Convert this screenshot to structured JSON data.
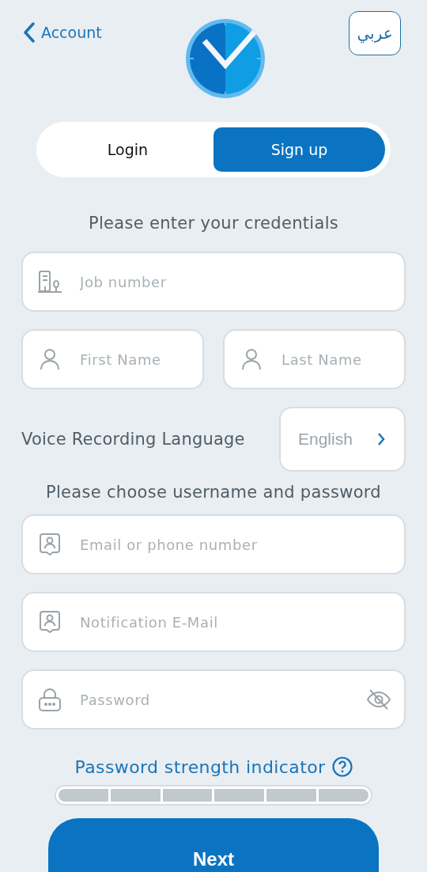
{
  "header": {
    "back_label": "Account",
    "language_button": "عربي"
  },
  "tabs": [
    {
      "label": "Login",
      "selected": false
    },
    {
      "label": "Sign up",
      "selected": true
    }
  ],
  "credentials_heading": "Please enter your credentials",
  "job_field": {
    "kind": "building",
    "placeholder": "Job number"
  },
  "name_fields": [
    {
      "kind": "person",
      "placeholder": "First Name"
    },
    {
      "kind": "person",
      "placeholder": "Last Name"
    }
  ],
  "voice_language": {
    "label": "Voice Recording Language",
    "value": "English"
  },
  "account_heading": "Please choose username and password",
  "account_fields": [
    {
      "kind": "contact",
      "placeholder": "Email or phone number"
    },
    {
      "kind": "contact",
      "placeholder": "Notification E-Mail"
    },
    {
      "kind": "lock",
      "placeholder": "Password",
      "password_visible": false
    }
  ],
  "strength": {
    "label": "Password strength indicator"
  },
  "next_button": "Next"
}
